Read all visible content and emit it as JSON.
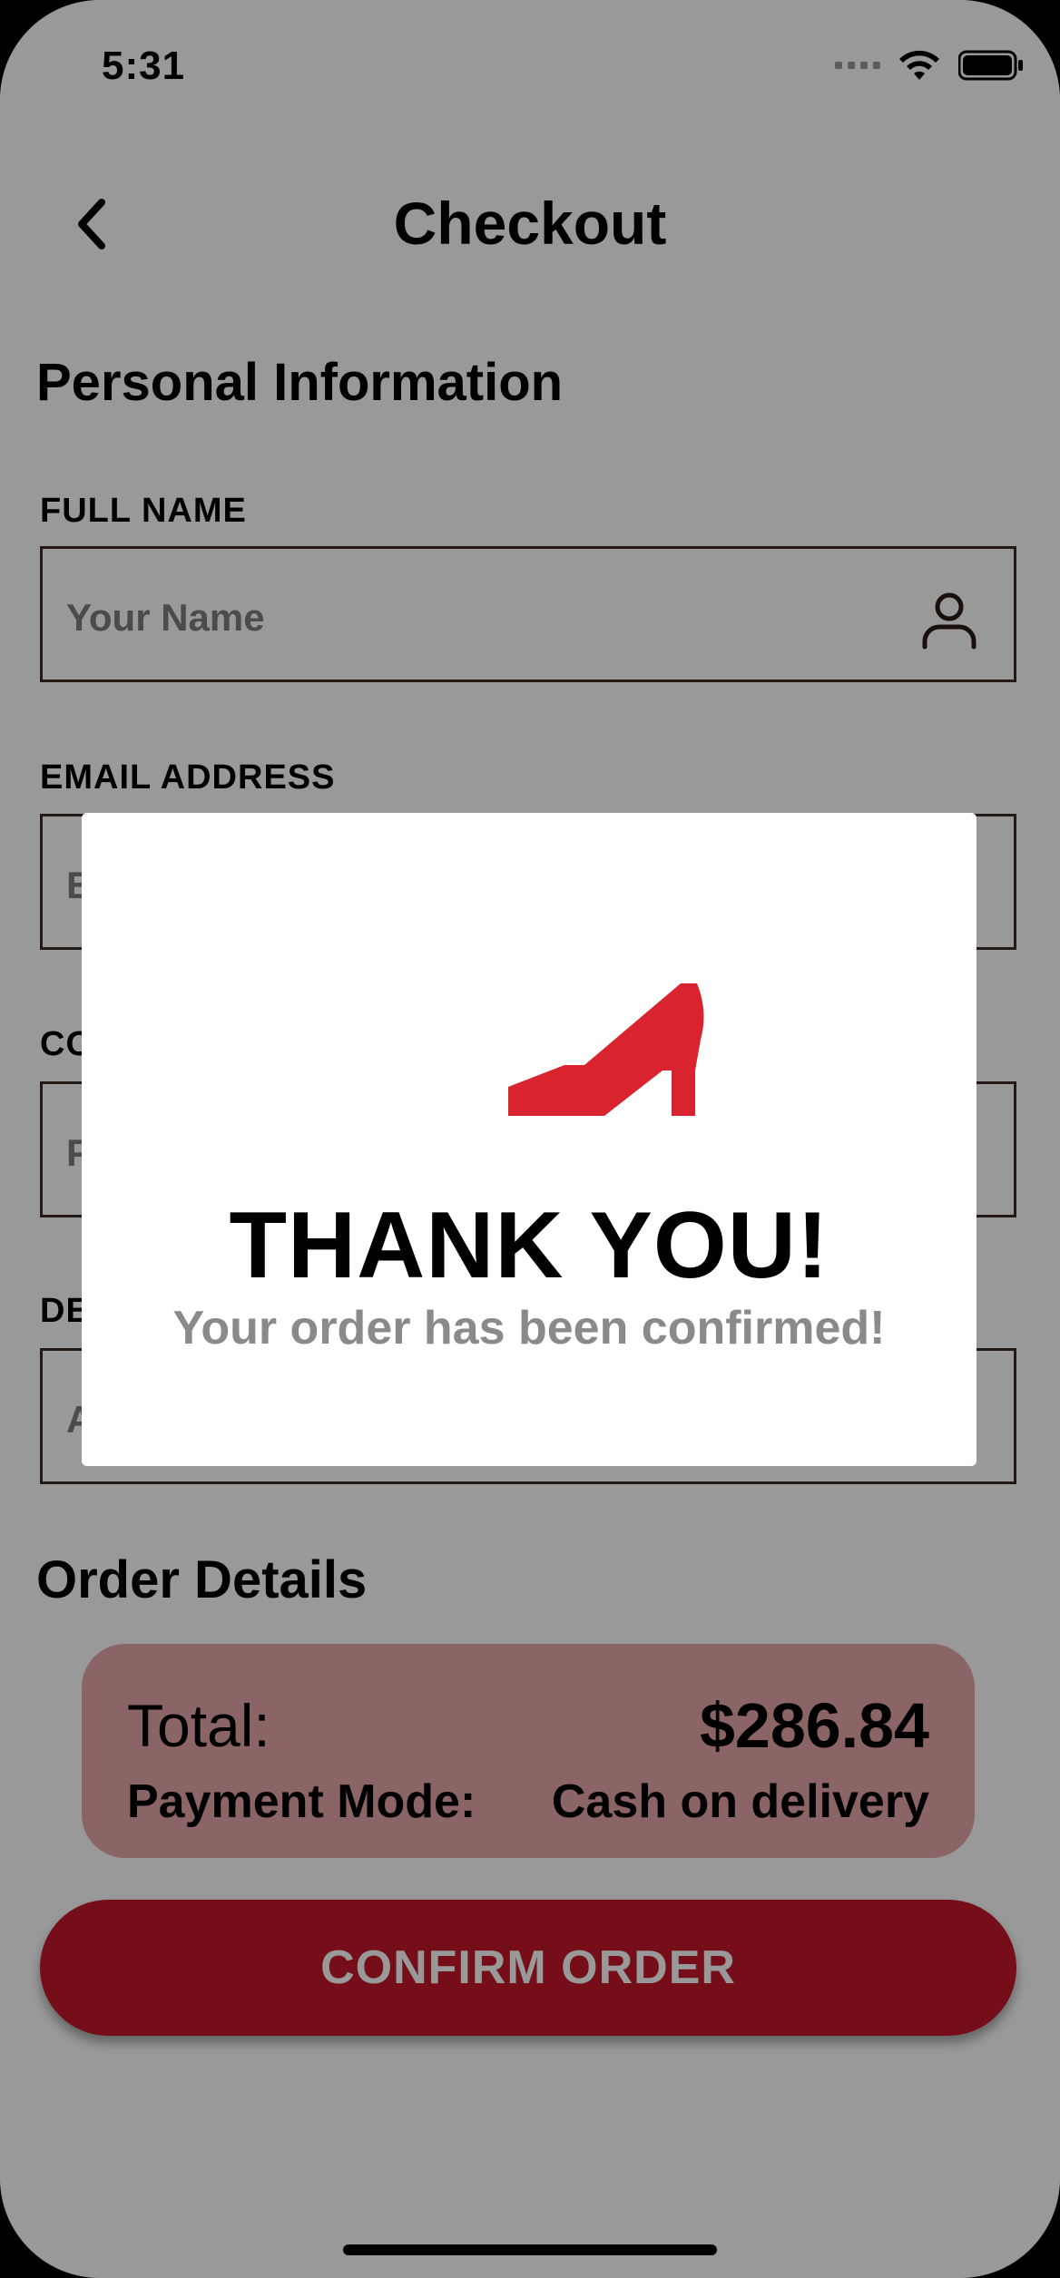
{
  "status_bar": {
    "time": "5:31"
  },
  "header": {
    "title": "Checkout"
  },
  "personal_info": {
    "title": "Personal Information",
    "fields": [
      {
        "label": "FULL NAME",
        "placeholder": "Your Name",
        "icon": "person-icon"
      },
      {
        "label": "EMAIL ADDRESS",
        "placeholder": "E",
        "icon": "mail-icon"
      },
      {
        "label": "CO",
        "placeholder": "P",
        "icon": "phone-icon"
      },
      {
        "label": "DE",
        "placeholder": "A",
        "icon": ""
      }
    ]
  },
  "order_details": {
    "title": "Order Details",
    "total_label": "Total:",
    "total_value": "$286.84",
    "payment_label": "Payment Mode:",
    "payment_value": "Cash on delivery"
  },
  "confirm_button": {
    "label": "CONFIRM ORDER"
  },
  "modal": {
    "icon": "shoe-icon",
    "title": "THANK YOU!",
    "message": "Your order has been confirmed!"
  },
  "colors": {
    "accent": "#c4182a",
    "order_card": "#e8a7ab",
    "shoe": "#d9232e",
    "overlay": "rgba(0,0,0,0.4)"
  }
}
